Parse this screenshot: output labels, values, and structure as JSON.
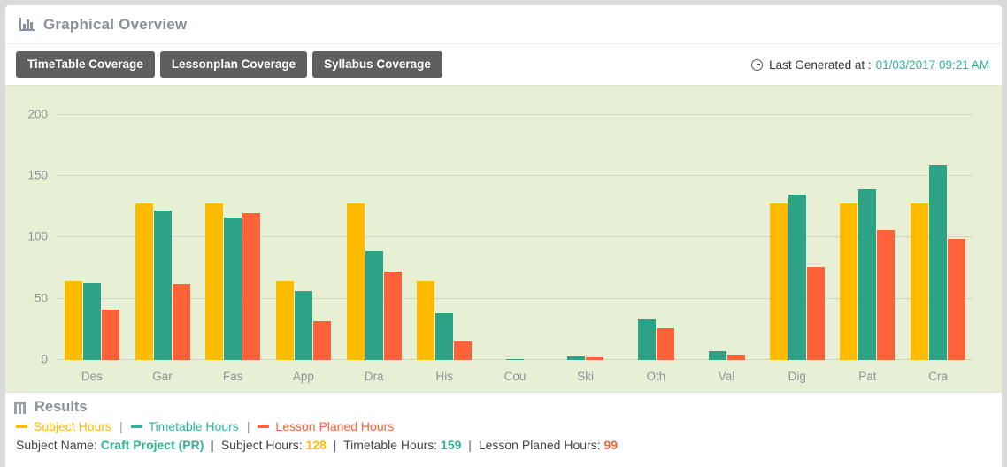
{
  "header": {
    "title": "Graphical Overview",
    "icon": "bar-chart-icon"
  },
  "toolbar": {
    "tabs": [
      {
        "label": "TimeTable Coverage"
      },
      {
        "label": "Lessonplan Coverage"
      },
      {
        "label": "Syllabus Coverage"
      }
    ],
    "generated": {
      "icon": "clock-icon",
      "label": "Last Generated at :",
      "value": "01/03/2017 09:21 AM",
      "value_color": "#2eb398"
    }
  },
  "results": {
    "icon": "results-icon",
    "title": "Results",
    "legend": [
      {
        "label": "Subject Hours",
        "color": "#ffbb00"
      },
      {
        "label": "Timetable Hours",
        "color": "#2eb398"
      },
      {
        "label": "Lesson Planed Hours",
        "color": "#ff6138"
      }
    ],
    "legend_separator": "|",
    "summary": {
      "subject_name_label": "Subject Name:",
      "subject_name_value": "Craft Project (PR)",
      "subject_name_color": "#2eb398",
      "subject_hours_label": "Subject Hours:",
      "subject_hours_value": "128",
      "subject_hours_color": "#ffbb00",
      "timetable_hours_label": "Timetable Hours:",
      "timetable_hours_value": "159",
      "timetable_hours_color": "#2eb398",
      "lesson_planed_label": "Lesson Planed Hours:",
      "lesson_planed_value": "99",
      "lesson_planed_color": "#ff6138",
      "separator": "|"
    }
  },
  "chart_data": {
    "type": "bar",
    "title": "",
    "xlabel": "",
    "ylabel": "",
    "ylim": [
      0,
      210
    ],
    "yticks": [
      0,
      50,
      100,
      150,
      200
    ],
    "grid": true,
    "legend_position": "below-chart",
    "background": "#e7f0d5",
    "categories": [
      "Des",
      "Gar",
      "Fas",
      "App",
      "Dra",
      "His",
      "Cou",
      "Ski",
      "Oth",
      "Val",
      "Dig",
      "Pat",
      "Cra"
    ],
    "series": [
      {
        "name": "Subject Hours",
        "color": "#ffbb00",
        "values": [
          64,
          128,
          128,
          64,
          128,
          64,
          0,
          0,
          0,
          0,
          128,
          128,
          128
        ]
      },
      {
        "name": "Timetable Hours",
        "color": "#2ea287",
        "values": [
          63,
          122,
          116,
          56,
          89,
          38,
          1,
          3,
          33,
          7,
          135,
          139,
          159
        ]
      },
      {
        "name": "Lesson Planed Hours",
        "color": "#ff6138",
        "values": [
          41,
          62,
          120,
          32,
          72,
          15,
          0,
          2,
          26,
          4,
          76,
          106,
          99
        ]
      }
    ]
  }
}
